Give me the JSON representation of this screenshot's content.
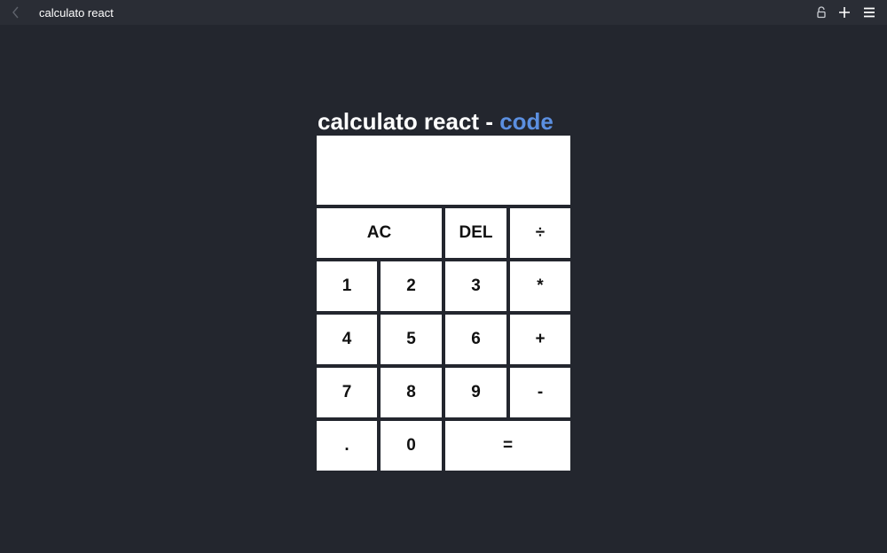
{
  "window": {
    "title": "calculato react"
  },
  "toolbar": {
    "back_icon": "chevron-left-icon",
    "lock_icon": "lock-icon",
    "plus_icon": "plus-icon",
    "menu_icon": "hamburger-menu-icon"
  },
  "calculator": {
    "heading": "calculato react - ",
    "code_link": "code",
    "display_value": "",
    "keys": {
      "ac": "AC",
      "del": "DEL",
      "divide": "÷",
      "one": "1",
      "two": "2",
      "three": "3",
      "multiply": "*",
      "four": "4",
      "five": "5",
      "six": "6",
      "plus": "+",
      "seven": "7",
      "eight": "8",
      "nine": "9",
      "minus": "-",
      "dot": ".",
      "zero": "0",
      "equals": "="
    }
  },
  "colors": {
    "background": "#23262e",
    "topbar": "#2a2d35",
    "link": "#5b8fe0",
    "key": "#ffffff"
  }
}
